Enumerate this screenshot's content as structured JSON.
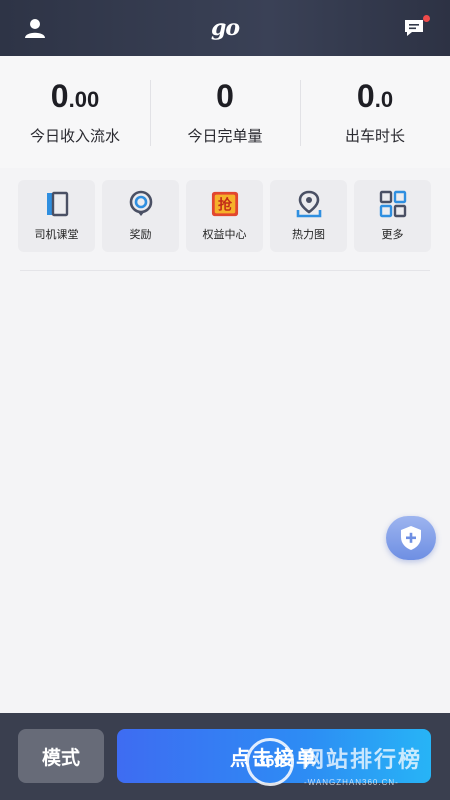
{
  "header": {
    "logo_text": "go",
    "icons": {
      "left": "user-icon",
      "right": "message-icon"
    },
    "colors": {
      "background": "#323849",
      "notification_dot": "#f04a4a"
    }
  },
  "stats": [
    {
      "int": "0",
      "dec": ".00",
      "label": "今日收入流水"
    },
    {
      "int": "0",
      "dec": "",
      "label": "今日完单量"
    },
    {
      "int": "0",
      "dec": ".0",
      "label": "出车时长"
    }
  ],
  "quick_actions": [
    {
      "label": "司机课堂",
      "icon": "book-icon"
    },
    {
      "label": "奖励",
      "icon": "reward-icon"
    },
    {
      "label": "权益中心",
      "icon": "grab-icon",
      "icon_text": "抢"
    },
    {
      "label": "热力图",
      "icon": "map-pin-icon"
    },
    {
      "label": "更多",
      "icon": "grid-icon"
    }
  ],
  "fab": {
    "icon": "shield-plus-icon"
  },
  "bottom": {
    "mode_label": "模式",
    "go_label": "点击接单",
    "colors": {
      "accent_start": "#3e6cf2",
      "accent_end": "#27b4f6"
    }
  },
  "watermark": {
    "circle_text": "360",
    "text": "网站排行榜",
    "sub": "-WANGZHAN360.CN-"
  }
}
